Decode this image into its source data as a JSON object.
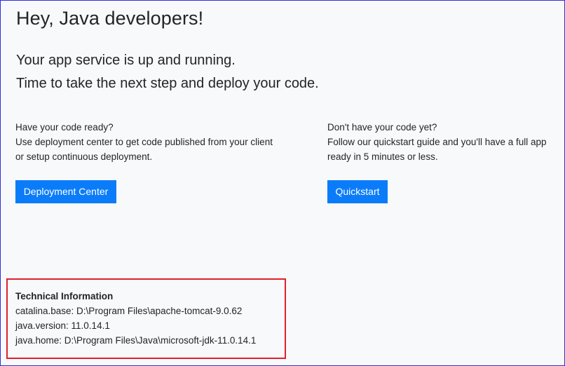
{
  "header": {
    "title": "Hey, Java developers!",
    "subtitle_line1": "Your app service is up and running.",
    "subtitle_line2": "Time to take the next step and deploy your code."
  },
  "left_column": {
    "line1": "Have your code ready?",
    "line2": "Use deployment center to get code published from your client or setup continuous deployment.",
    "button_label": "Deployment Center"
  },
  "right_column": {
    "line1": "Don't have your code yet?",
    "line2": "Follow our quickstart guide and you'll have a full app ready in 5 minutes or less.",
    "button_label": "Quickstart"
  },
  "technical_info": {
    "heading": "Technical Information",
    "catalina_base": "catalina.base: D:\\Program Files\\apache-tomcat-9.0.62",
    "java_version": "java.version: 11.0.14.1",
    "java_home": "java.home: D:\\Program Files\\Java\\microsoft-jdk-11.0.14.1"
  },
  "colors": {
    "button_bg": "#0b7cf9",
    "page_bg": "#f8f9fa",
    "highlight_border": "#e0202a",
    "window_border": "#2e2ee0"
  }
}
